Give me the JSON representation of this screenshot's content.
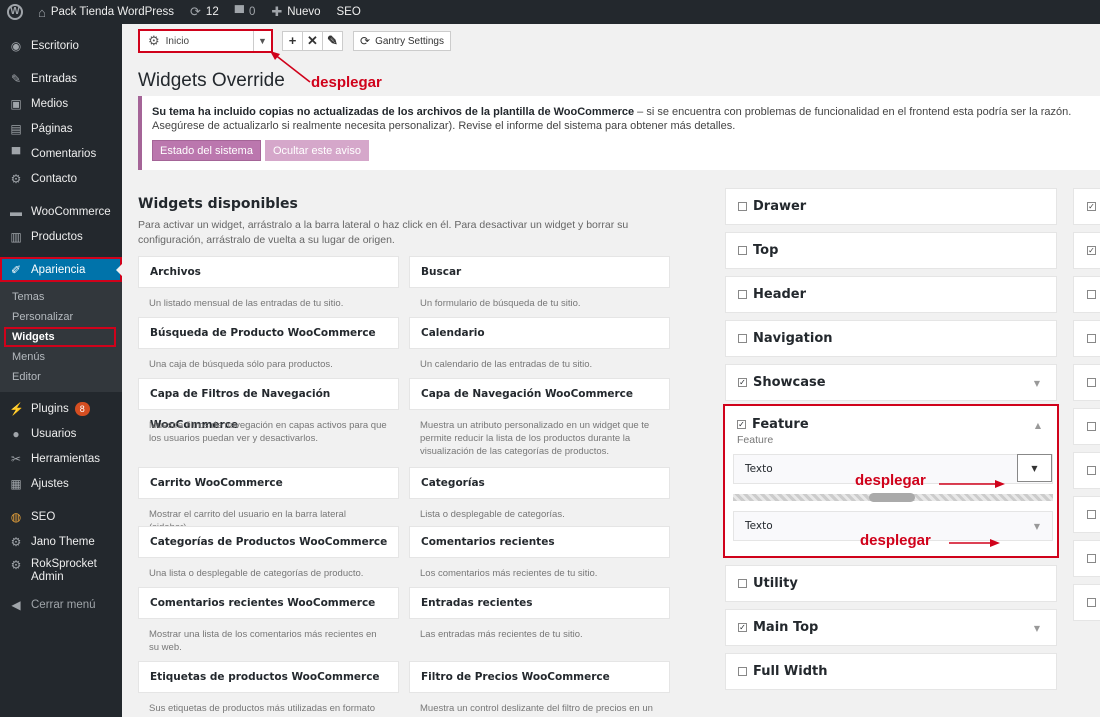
{
  "adminbar": {
    "site_name": "Pack Tienda WordPress",
    "updates": "12",
    "comments": "0",
    "new_label": "Nuevo",
    "seo_label": "SEO"
  },
  "sidebar": {
    "items": [
      {
        "label": "Escritorio",
        "icon": "dashboard-icon"
      },
      {
        "label": "Entradas",
        "icon": "pin-icon"
      },
      {
        "label": "Medios",
        "icon": "media-icon"
      },
      {
        "label": "Páginas",
        "icon": "pages-icon"
      },
      {
        "label": "Comentarios",
        "icon": "comments-icon"
      },
      {
        "label": "Contacto",
        "icon": "gear-icon"
      },
      {
        "label": "WooCommerce",
        "icon": "woocommerce-icon"
      },
      {
        "label": "Productos",
        "icon": "products-icon"
      },
      {
        "label": "Apariencia",
        "icon": "brush-icon"
      },
      {
        "label": "Plugins",
        "icon": "plugins-icon",
        "badge": "8"
      },
      {
        "label": "Usuarios",
        "icon": "users-icon"
      },
      {
        "label": "Herramientas",
        "icon": "tools-icon"
      },
      {
        "label": "Ajustes",
        "icon": "settings-icon"
      },
      {
        "label": "SEO",
        "icon": "seo-icon"
      },
      {
        "label": "Jano Theme",
        "icon": "gear-icon"
      },
      {
        "label": "RokSprocket Admin",
        "icon": "gear-icon"
      },
      {
        "label": "Cerrar menú",
        "icon": "collapse-icon"
      }
    ],
    "submenu": [
      "Temas",
      "Personalizar",
      "Widgets",
      "Menús",
      "Editor"
    ]
  },
  "toolbar": {
    "override_select": "Inicio",
    "gantry_label": "Gantry Settings",
    "annot_label": "desplegar"
  },
  "page_title": "Widgets Override",
  "notice": {
    "bold": "Su tema ha incluido copias no actualizadas de los archivos de la plantilla de WooCommerce",
    "text": " – si se encuentra con problemas de funcionalidad en el frontend esta podría ser la razón. Asegúrese de actualizarlo si realmente necesita personalizar). Revise el informe del sistema para obtener más detalles.",
    "btn_status": "Estado del sistema",
    "btn_hide": "Ocultar este aviso"
  },
  "available": {
    "title": "Widgets disponibles",
    "desc": "Para activar un widget, arrástralo a la barra lateral o haz click en él. Para desactivar un widget y borrar su configuración, arrástralo de vuelta a su lugar de origen.",
    "widgets": [
      {
        "title": "Archivos",
        "desc": "Un listado mensual de las entradas de tu sitio."
      },
      {
        "title": "Buscar",
        "desc": "Un formulario de búsqueda de tu sitio."
      },
      {
        "title": "Búsqueda de Producto WooCommerce",
        "desc": "Una caja de búsqueda sólo para productos."
      },
      {
        "title": "Calendario",
        "desc": "Un calendario de las entradas de tu sitio."
      },
      {
        "title": "Capa de Filtros de Navegación WooCommerce",
        "desc": "Muestra filtros de navegación en capas activos para que los usuarios puedan ver y desactivarlos."
      },
      {
        "title": "Capa de Navegación WooCommerce",
        "desc": "Muestra un atributo personalizado en un widget que te permite reducir la lista de los productos durante la visualización de las categorías de productos."
      },
      {
        "title": "Carrito WooCommerce",
        "desc": "Mostrar el carrito del usuario en la barra lateral (sidebar)."
      },
      {
        "title": "Categorías",
        "desc": "Lista o desplegable de categorías."
      },
      {
        "title": "Categorías de Productos WooCommerce",
        "desc": "Una lista o desplegable de categorías de producto."
      },
      {
        "title": "Comentarios recientes",
        "desc": "Los comentarios más recientes de tu sitio."
      },
      {
        "title": "Comentarios recientes WooCommerce",
        "desc": "Mostrar una lista de los comentarios más recientes en su web."
      },
      {
        "title": "Entradas recientes",
        "desc": "Las entradas más recientes de tu sitio."
      },
      {
        "title": "Etiquetas de productos WooCommerce",
        "desc": "Sus etiquetas de productos más utilizadas en formato de"
      },
      {
        "title": "Filtro de Precios WooCommerce",
        "desc": "Muestra un control deslizante del filtro de precios en un"
      }
    ]
  },
  "sidebars": {
    "drawer": "Drawer",
    "top": "Top",
    "header": "Header",
    "navigation": "Navigation",
    "showcase": "Showcase",
    "feature": "Feature",
    "feature_sub": "Feature",
    "texto1": "Texto",
    "texto2": "Texto",
    "annot1": "desplegar",
    "annot2": "desplegar",
    "utility": "Utility",
    "main_top": "Main Top",
    "full_width": "Full Width"
  },
  "colors": {
    "accent": "#0073aa",
    "annotation": "#d0021b",
    "woo": "#a46497"
  }
}
